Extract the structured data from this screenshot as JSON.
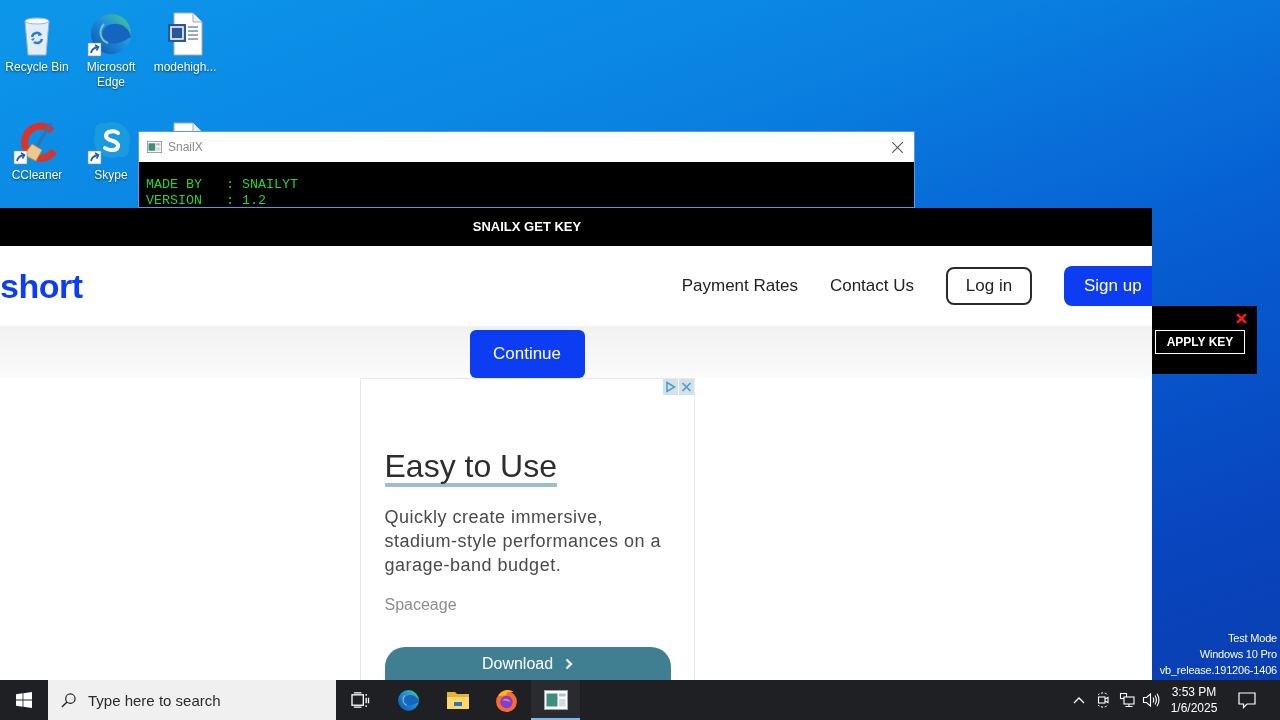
{
  "desktop_icons": [
    {
      "label": "Recycle Bin",
      "kind": "recycle",
      "shortcut": false
    },
    {
      "label": "Microsoft Edge",
      "kind": "edge",
      "shortcut": true
    },
    {
      "label": "modehigh...",
      "kind": "document",
      "shortcut": false
    },
    {
      "label": "CCleaner",
      "kind": "cleaner",
      "shortcut": true
    },
    {
      "label": "Skype",
      "kind": "skype",
      "shortcut": true
    },
    {
      "kind": "document"
    }
  ],
  "console_window": {
    "title": "SnailX",
    "lines": [
      "MADE BY   : SNAILYT",
      "VERSION   : 1.2"
    ]
  },
  "key_window": {
    "title": "SNAILX GET KEY",
    "logo": "short",
    "nav": [
      {
        "label": "Payment Rates",
        "kind": "link"
      },
      {
        "label": "Contact Us",
        "kind": "link"
      },
      {
        "label": "Log in",
        "kind": "login"
      },
      {
        "label": "Sign up",
        "kind": "signup"
      }
    ],
    "continue_button": "Continue",
    "ad": {
      "headline": "Easy to Use",
      "body": "Quickly create immersive, stadium-style performances on a garage-band budget.",
      "advertiser": "Spaceage",
      "button": "Download"
    }
  },
  "apply_panel": {
    "button": "APPLY KEY"
  },
  "build_info": [
    "Test Mode",
    "Windows 10 Pro",
    "vb_release.191206-1406"
  ],
  "taskbar": {
    "search": {
      "placeholder": "Type here to search"
    },
    "apps": [
      {
        "kind": "edge",
        "selected": false
      },
      {
        "kind": "folder",
        "selected": false
      },
      {
        "kind": "firefox",
        "selected": false
      },
      {
        "kind": "console",
        "selected": true
      }
    ],
    "clock": {
      "time": "3:53 PM",
      "date": "1/6/2025"
    }
  }
}
